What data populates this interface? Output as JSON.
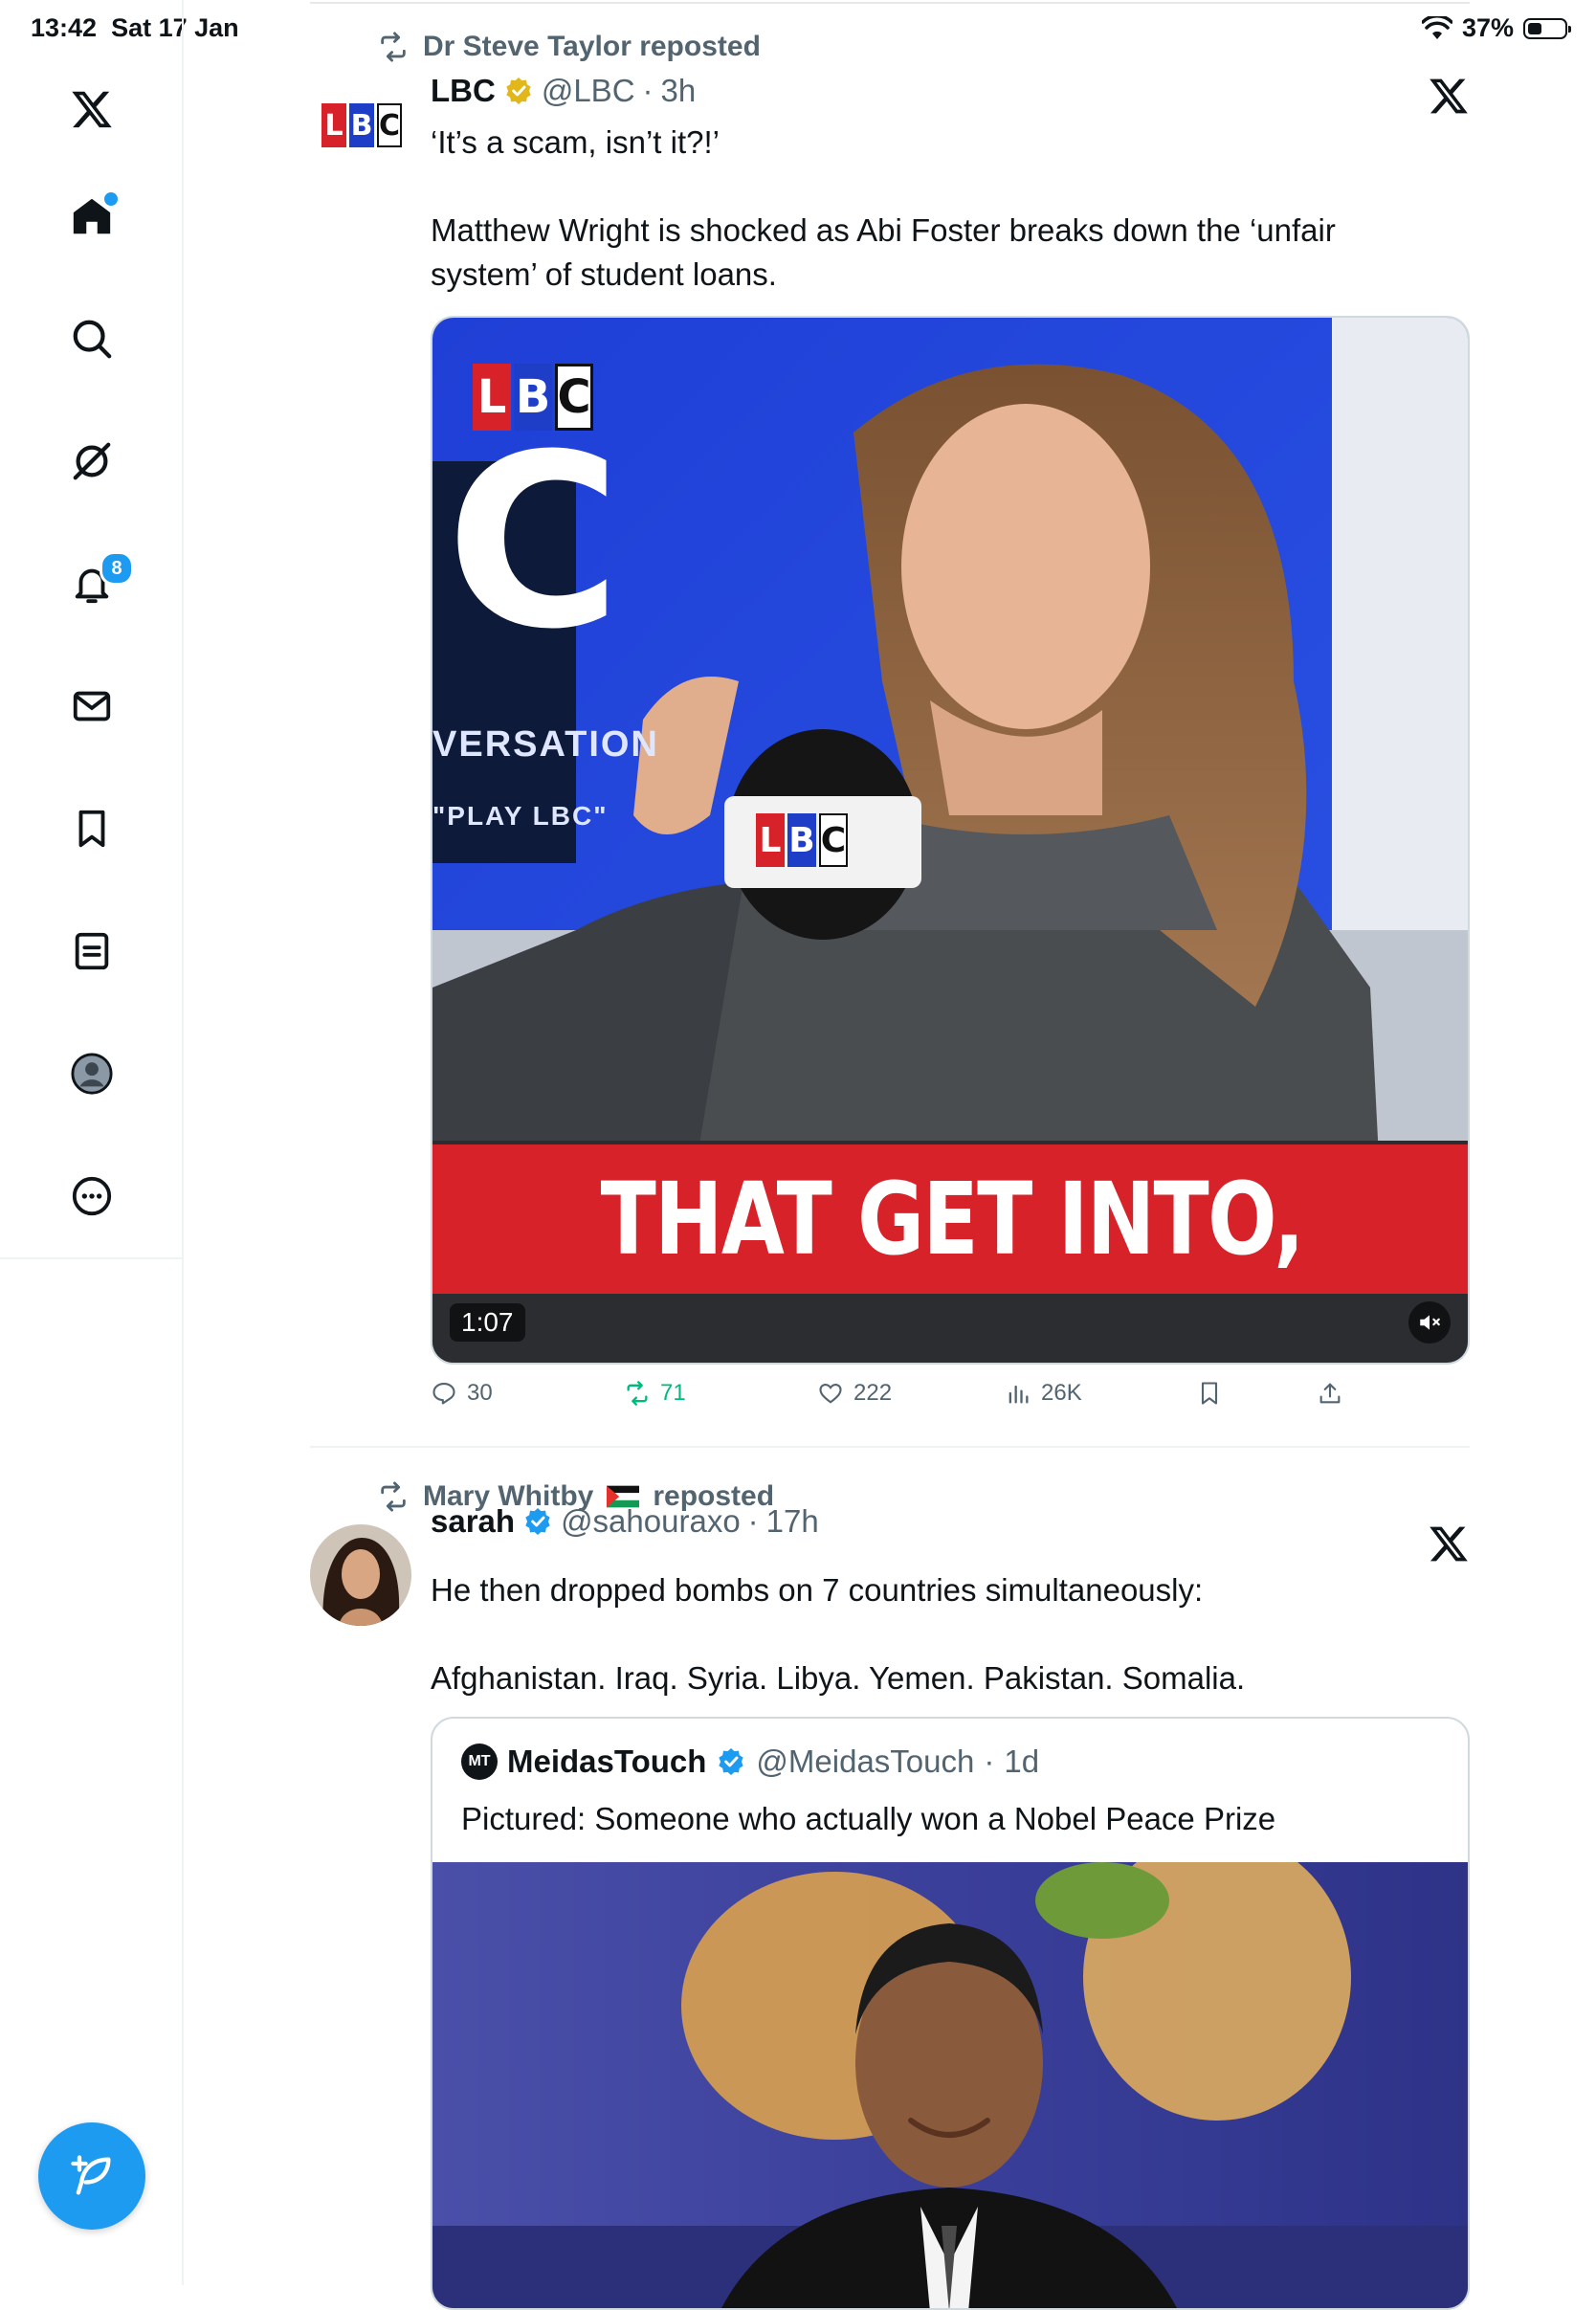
{
  "status_bar": {
    "time": "13:42",
    "date": "Sat 17 Jan",
    "battery": "37%"
  },
  "sidebar": {
    "items": [
      {
        "name": "home"
      },
      {
        "name": "search"
      },
      {
        "name": "grok"
      },
      {
        "name": "notifications",
        "badge": "8"
      },
      {
        "name": "messages"
      },
      {
        "name": "bookmarks"
      },
      {
        "name": "lists"
      },
      {
        "name": "profile"
      },
      {
        "name": "more"
      }
    ]
  },
  "tweets": [
    {
      "repost_label": "Dr Steve Taylor reposted",
      "name": "LBC",
      "handle": "@LBC",
      "time": "3h",
      "text": "‘It’s a scam, isn’t it?!’\n\nMatthew Wright is shocked as Abi Foster breaks down the ‘unfair system’ of student loans.",
      "video": {
        "logo_letters": [
          "L",
          "B",
          "C"
        ],
        "big_letter": "C",
        "wall_text_1": "VERSATION",
        "wall_text_2": "\"PLAY LBC\"",
        "caption": "THAT GET INTO,",
        "duration": "1:07"
      },
      "stats": {
        "replies": "30",
        "reposts": "71",
        "likes": "222",
        "views": "26K"
      }
    },
    {
      "repost_label": "Mary Whitby 🇵🇸 reposted",
      "repost_name": "Mary Whitby",
      "repost_suffix": "reposted",
      "name": "sarah",
      "handle": "@sahouraxo",
      "time": "17h",
      "text": "He then dropped bombs on 7 countries simultaneously:\n\nAfghanistan. Iraq. Syria. Libya. Yemen. Pakistan. Somalia.",
      "quote": {
        "logo": "MT",
        "name": "MeidasTouch",
        "handle": "@MeidasTouch",
        "time": "1d",
        "text": "Pictured: Someone who actually won a Nobel Peace Prize"
      }
    }
  ],
  "colors": {
    "accent": "#1d9bf0",
    "text": "#0f1419",
    "muted": "#536471",
    "repost_green": "#00ba7c",
    "gold": "#e2b719",
    "lbc_red": "#d7222a",
    "lbc_blue": "#1e3ec8"
  }
}
